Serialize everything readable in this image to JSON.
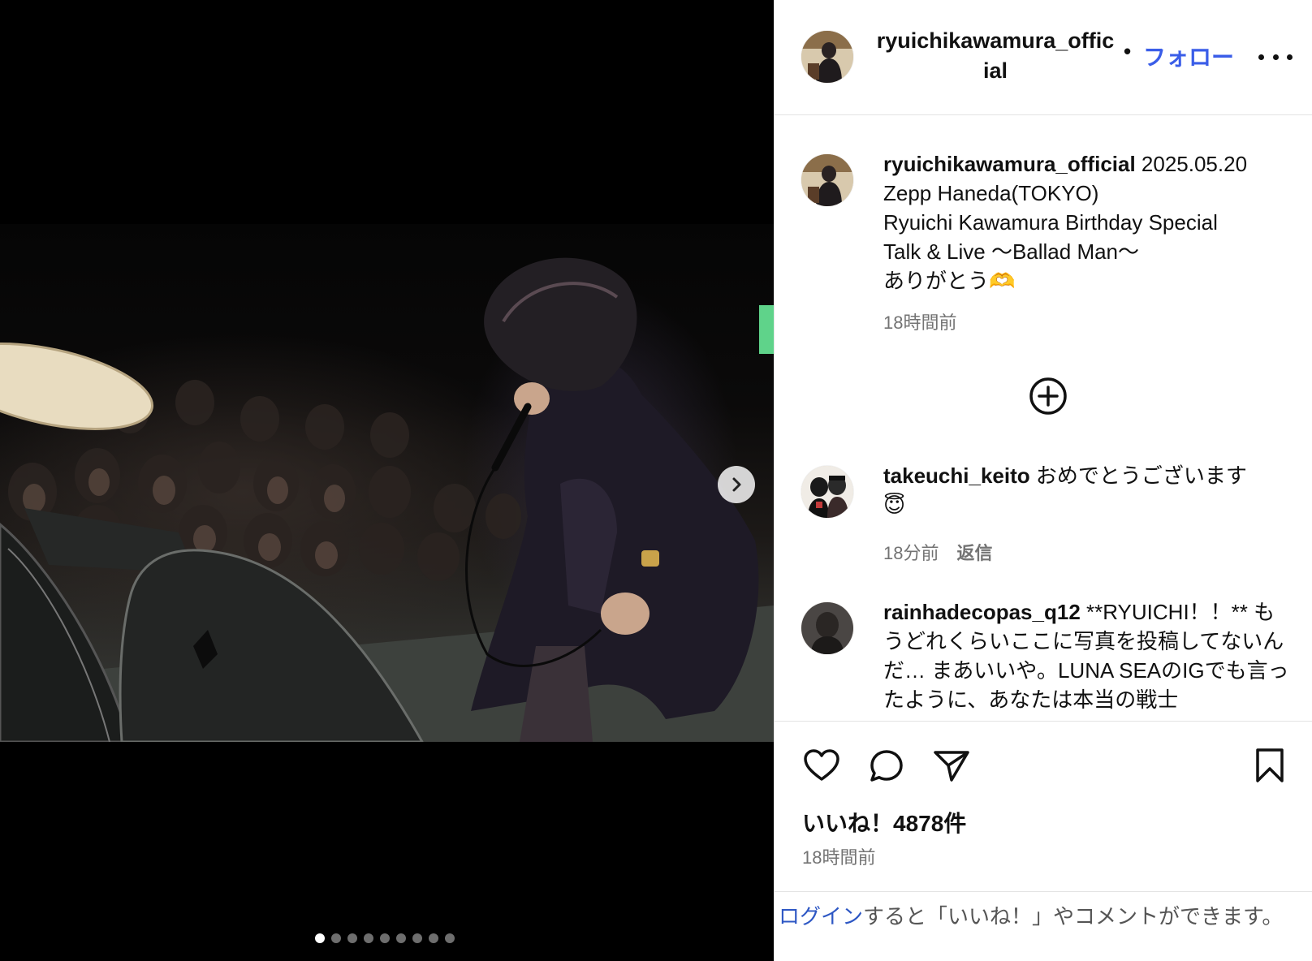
{
  "media": {
    "image_alt": "",
    "slide_count": 9,
    "active_slide": 1,
    "next_icon": "chevron-right-icon"
  },
  "header": {
    "username": "ryuichikawamura_official",
    "separator": "•",
    "follow_label": "フォロー",
    "more_icon": "more-horizontal-icon"
  },
  "caption": {
    "username": "ryuichikawamura_official",
    "text_line1": " 2025.05.20",
    "text_line2": "Zepp Haneda(TOKYO)",
    "text_line3": "Ryuichi Kawamura Birthday Special",
    "text_line4": "Talk & Live 〜Ballad Man〜",
    "text_line5": "ありがとう",
    "emoji": "🫶",
    "time": "18時間前"
  },
  "load_more_icon": "plus-circle-icon",
  "comments": [
    {
      "username": "takeuchi_keito",
      "text": " おめでとうございます",
      "emoji": "😇",
      "time": "18分前",
      "reply_label": "返信"
    },
    {
      "username": "rainhadecopas_q12",
      "text": " **RYUICHI！！** もうどれくらいここに写真を投稿してないんだ… まあいいや。LUNA SEAのIGでも言ったように、あなたは本当の戦士"
    }
  ],
  "actions": {
    "like_icon": "heart-icon",
    "comment_icon": "comment-icon",
    "share_icon": "send-icon",
    "save_icon": "bookmark-icon",
    "likes_text": "いいね！4878件",
    "time": "18時間前"
  },
  "login_prompt": {
    "link_label": "ログイン",
    "text": "すると「いいね！」やコメントができます。"
  },
  "colors": {
    "accent": "#3a5de8",
    "link": "#2d57c4",
    "muted": "#737373"
  }
}
